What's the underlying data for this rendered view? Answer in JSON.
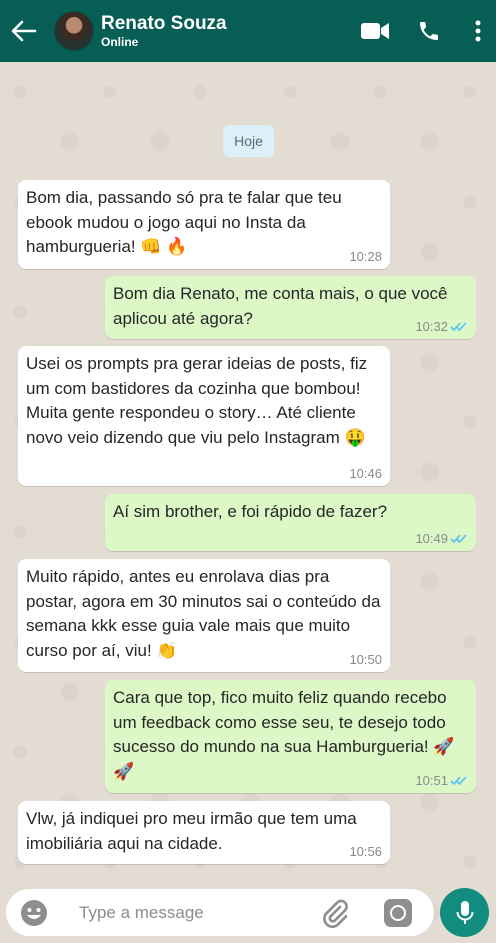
{
  "header": {
    "contact_name": "Renato Souza",
    "status": "Online",
    "icons": [
      "back-arrow-icon",
      "avatar",
      "video-call-icon",
      "phone-icon",
      "more-options-icon"
    ],
    "colors": {
      "bar": "#075e54"
    }
  },
  "chat": {
    "date_chip": "Hoje",
    "messages": [
      {
        "direction": "in",
        "text": "Bom dia, passando só pra te falar que teu ebook mudou o jogo aqui no Insta da hamburgueria! 👊 🔥",
        "time": "10:28"
      },
      {
        "direction": "out",
        "text": "Bom dia Renato, me conta mais, o que você aplicou até agora?",
        "time": "10:32",
        "read": true
      },
      {
        "direction": "in",
        "text": "Usei os prompts pra gerar ideias de posts, fiz um com bastidores da cozinha que bombou! Muita gente respondeu o story… Até cliente novo veio dizendo que viu pelo Instagram 🤑",
        "time": "10:46"
      },
      {
        "direction": "out",
        "text": "Aí sim brother, e foi rápido de fazer?",
        "time": "10:49",
        "read": true
      },
      {
        "direction": "in",
        "text": "Muito rápido, antes eu enrolava dias pra postar, agora em 30 minutos sai o conteúdo da semana kkk esse guia vale mais que muito curso por aí, viu! 👏",
        "time": "10:50"
      },
      {
        "direction": "out",
        "text": "Cara que top, fico muito feliz quando recebo um feedback como esse seu, te desejo todo sucesso do mundo na sua Hamburgueria! 🚀 🚀",
        "time": "10:51",
        "read": true
      },
      {
        "direction": "in",
        "text": "Vlw, já indiquei pro meu irmão que tem uma imobiliária aqui na cidade.",
        "time": "10:56"
      }
    ],
    "colors": {
      "incoming": "#ffffff",
      "outgoing": "#dcf8c6",
      "read_ticks": "#4fc3f7"
    }
  },
  "composer": {
    "placeholder": "Type a message",
    "icons": [
      "emoji-icon",
      "attach-icon",
      "camera-icon",
      "mic-icon"
    ],
    "colors": {
      "send_button": "#128c7e"
    }
  }
}
